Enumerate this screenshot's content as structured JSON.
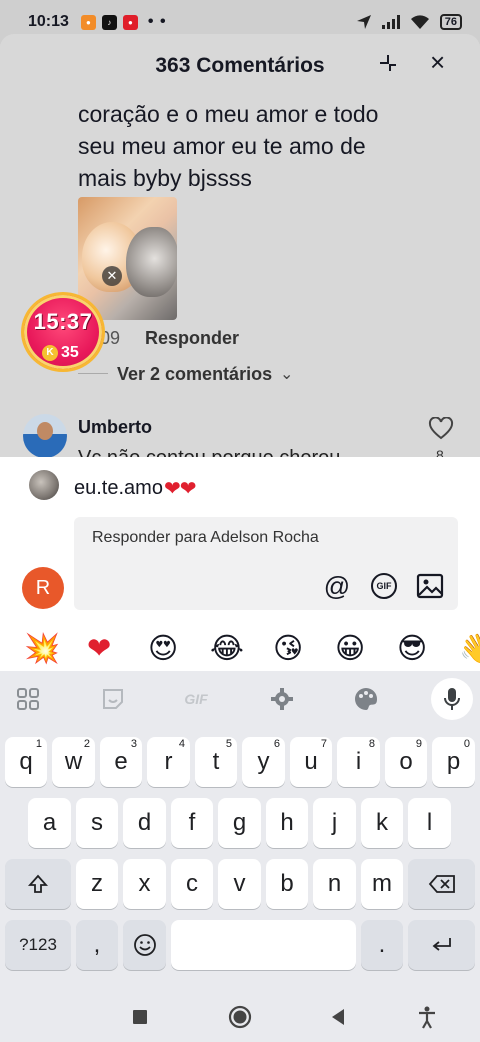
{
  "status_bar": {
    "time": "10:13",
    "dots": "• •",
    "battery": "76"
  },
  "comments": {
    "title": "363 Comentários",
    "comment_text": "coração e o meu amor e todo seu meu amor eu te amo de mais byby bjssss",
    "comment_date": "09",
    "reply_label": "Responder",
    "view_replies_label": "Ver 2 comentários",
    "next_user_name": "Umberto",
    "next_comment_partial": "Vc não contou porque chorou",
    "next_like_count": "8"
  },
  "timer": {
    "time": "15:37",
    "coins": "35",
    "coin_letter": "K"
  },
  "composer": {
    "draft_text": "eu.te.amo",
    "draft_hearts": "❤❤",
    "user_initial": "R",
    "reply_placeholder": "Responder para Adelson Rocha"
  },
  "emoji_bar": [
    "💥",
    "❤",
    "😍",
    "😂",
    "😘",
    "😀",
    "😎",
    "👋"
  ],
  "keyboard": {
    "toolbar_gif": "GIF",
    "row1": [
      {
        "label": "q",
        "hint": "1"
      },
      {
        "label": "w",
        "hint": "2"
      },
      {
        "label": "e",
        "hint": "3"
      },
      {
        "label": "r",
        "hint": "4"
      },
      {
        "label": "t",
        "hint": "5"
      },
      {
        "label": "y",
        "hint": "6"
      },
      {
        "label": "u",
        "hint": "7"
      },
      {
        "label": "i",
        "hint": "8"
      },
      {
        "label": "o",
        "hint": "9"
      },
      {
        "label": "p",
        "hint": "0"
      }
    ],
    "row2": [
      "a",
      "s",
      "d",
      "f",
      "g",
      "h",
      "j",
      "k",
      "l"
    ],
    "row3": [
      "z",
      "x",
      "c",
      "v",
      "b",
      "n",
      "m"
    ],
    "symbols_label": "?123",
    "comma_label": ",",
    "period_label": "."
  },
  "colors": {
    "accent": "#e8185a",
    "avatar_bg": "#e8582a",
    "heart": "#e0202f"
  }
}
